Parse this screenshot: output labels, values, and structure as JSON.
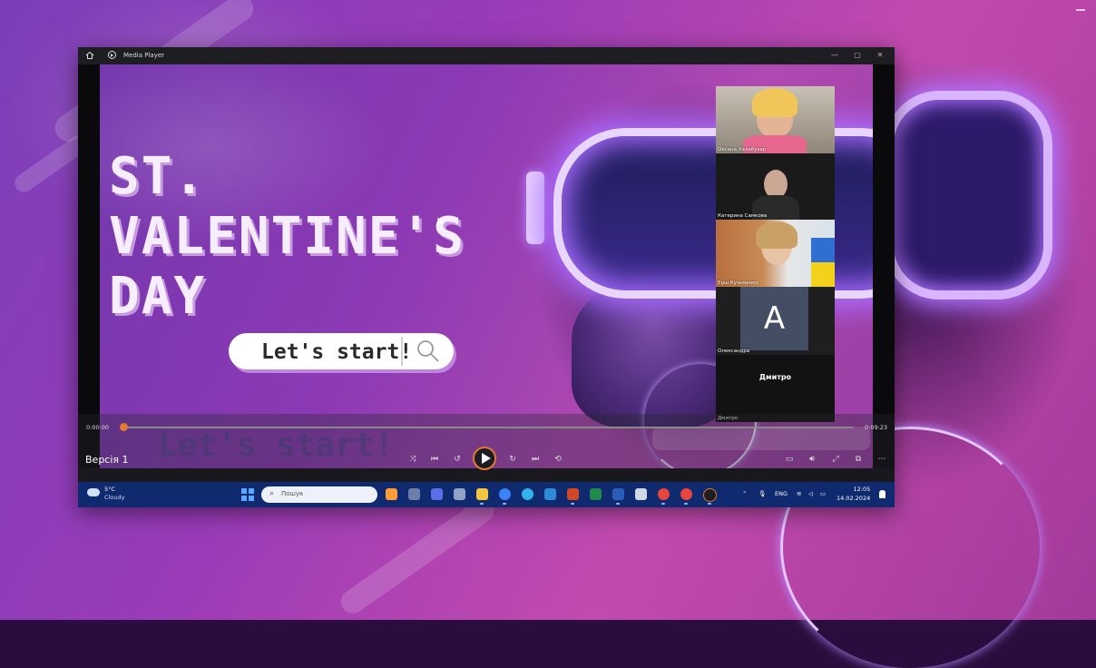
{
  "window": {
    "title": "Media Player",
    "controls": {
      "minimize": "—",
      "maximize": "▢",
      "close": "✕"
    }
  },
  "slide": {
    "title_lines": [
      "ST.",
      "VALENTINE'S",
      "DAY"
    ],
    "search_button_text": "Let's start!",
    "ghost_text": "Let's start!"
  },
  "participants": [
    {
      "name": "Оксана Халабузар"
    },
    {
      "name": "Катерина Самкова"
    },
    {
      "name": "Ерш Кузьменко"
    },
    {
      "name": "Олександра",
      "initial": "A"
    },
    {
      "name": "Дмитро",
      "center_label": "Дмитро"
    }
  ],
  "player": {
    "time_current": "0:00:00",
    "time_total": "0:09:23",
    "progress": 0.0,
    "version_label": "Версія 1",
    "accent_color": "#e07a2e"
  },
  "taskbar": {
    "weather_temp": "5°C",
    "weather_desc": "Cloudy",
    "search_placeholder": "Пошук",
    "language": "ENG",
    "time": "12:05",
    "date": "14.02.2024",
    "bg_color": "#0f2a6e"
  },
  "icons": {
    "home": "home-icon",
    "app": "media-player-icon",
    "shuffle": "shuffle-icon",
    "previous": "previous-icon",
    "rewind": "rewind-10-icon",
    "play": "play-icon",
    "forward": "forward-30-icon",
    "next": "next-icon",
    "repeat": "repeat-off-icon",
    "subtitles": "subtitles-icon",
    "volume": "volume-icon",
    "fullscreen": "fullscreen-icon",
    "miniplayer": "miniplayer-icon",
    "more": "more-icon"
  }
}
